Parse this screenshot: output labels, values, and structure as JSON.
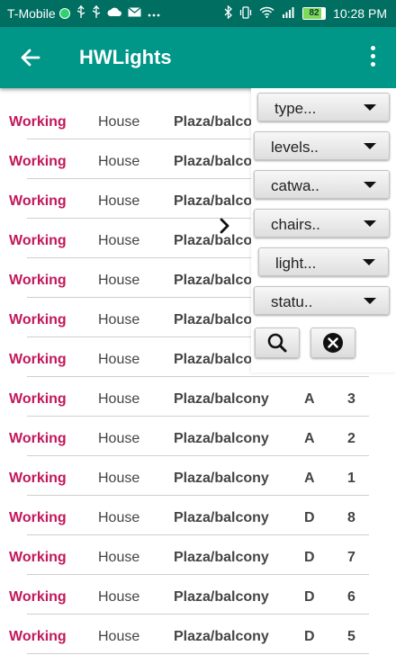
{
  "status_bar": {
    "carrier": "T-Mobile",
    "battery": "82",
    "time": "10:28 PM",
    "left_icons": [
      "signal-dot-icon",
      "usb-icon",
      "usb-icon",
      "cloud-icon",
      "mail-icon",
      "more-icon"
    ],
    "right_icons": [
      "bluetooth-icon",
      "vibrate-icon",
      "wifi-icon",
      "cell-signal-icon",
      "battery-icon"
    ]
  },
  "app_bar": {
    "title": "HWLights",
    "back_icon": "arrow-left-icon",
    "menu_icon": "more-vert-icon"
  },
  "filters": [
    {
      "label": "type..."
    },
    {
      "label": "levels.."
    },
    {
      "label": "catwa.."
    },
    {
      "label": "chairs.."
    },
    {
      "label": "light..."
    },
    {
      "label": "statu.."
    }
  ],
  "actions": {
    "search_icon": "search-icon",
    "clear_icon": "clear-circle-icon"
  },
  "collapse_icon": "chevron-right-icon",
  "rows": [
    {
      "status": "Working",
      "type": "House",
      "location": "Plaza/balcony",
      "level": "",
      "number": ""
    },
    {
      "status": "Working",
      "type": "House",
      "location": "Plaza/balcony",
      "level": "",
      "number": ""
    },
    {
      "status": "Working",
      "type": "House",
      "location": "Plaza/balcony",
      "level": "",
      "number": ""
    },
    {
      "status": "Working",
      "type": "House",
      "location": "Plaza/balcony",
      "level": "",
      "number": ""
    },
    {
      "status": "Working",
      "type": "House",
      "location": "Plaza/balcony",
      "level": "",
      "number": ""
    },
    {
      "status": "Working",
      "type": "House",
      "location": "Plaza/balcony",
      "level": "",
      "number": ""
    },
    {
      "status": "Working",
      "type": "House",
      "location": "Plaza/balcony",
      "level": "",
      "number": ""
    },
    {
      "status": "Working",
      "type": "House",
      "location": "Plaza/balcony",
      "level": "A",
      "number": "3"
    },
    {
      "status": "Working",
      "type": "House",
      "location": "Plaza/balcony",
      "level": "A",
      "number": "2"
    },
    {
      "status": "Working",
      "type": "House",
      "location": "Plaza/balcony",
      "level": "A",
      "number": "1"
    },
    {
      "status": "Working",
      "type": "House",
      "location": "Plaza/balcony",
      "level": "D",
      "number": "8"
    },
    {
      "status": "Working",
      "type": "House",
      "location": "Plaza/balcony",
      "level": "D",
      "number": "7"
    },
    {
      "status": "Working",
      "type": "House",
      "location": "Plaza/balcony",
      "level": "D",
      "number": "6"
    },
    {
      "status": "Working",
      "type": "House",
      "location": "Plaza/balcony",
      "level": "D",
      "number": "5"
    }
  ],
  "colors": {
    "status_bar": "#006e61",
    "app_bar": "#009688",
    "status_text": "#c2185b"
  }
}
